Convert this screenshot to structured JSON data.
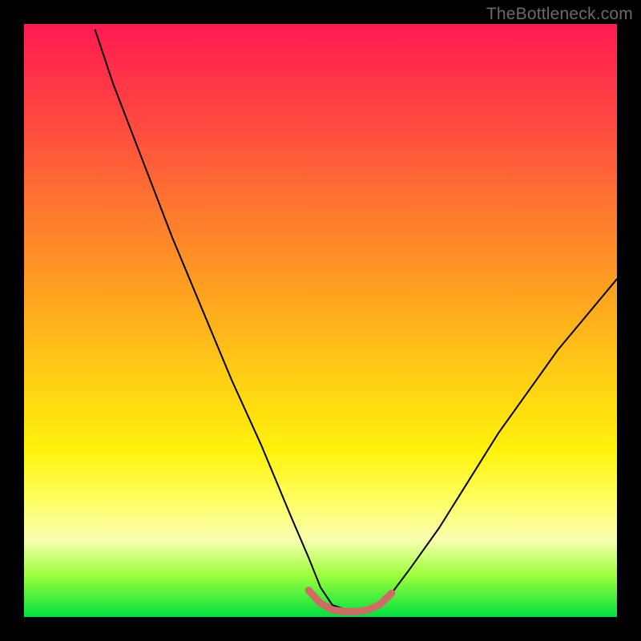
{
  "watermark": {
    "text": "TheBottleneck.com"
  },
  "chart_data": {
    "type": "line",
    "title": "",
    "xlabel": "",
    "ylabel": "",
    "xlim": [
      0,
      100
    ],
    "ylim": [
      0,
      100
    ],
    "grid": false,
    "legend": false,
    "series": [
      {
        "name": "bottleneck-curve",
        "x": [
          12,
          15,
          20,
          25,
          30,
          35,
          40,
          45,
          48,
          50,
          52,
          55,
          58,
          60,
          62,
          65,
          70,
          75,
          80,
          85,
          90,
          95,
          100
        ],
        "y": [
          99,
          90,
          77,
          64,
          52,
          40,
          29,
          17,
          10,
          5,
          2,
          1,
          1,
          2,
          4,
          8,
          15,
          23,
          31,
          38,
          45,
          51,
          57
        ],
        "stroke": "#000000",
        "stroke_width": 2
      }
    ],
    "markers": [
      {
        "name": "optimal-region-marker",
        "x": [
          48,
          50,
          52,
          54,
          56,
          58,
          60,
          62
        ],
        "y": [
          4.5,
          2.3,
          1.2,
          0.9,
          0.9,
          1.2,
          2.1,
          4.0
        ],
        "stroke": "#d06a64",
        "stroke_width": 9,
        "linecap": "round"
      }
    ],
    "background_gradient": {
      "direction": "top-to-bottom",
      "stops": [
        {
          "pos": 0.0,
          "color": "#ff1a52"
        },
        {
          "pos": 0.18,
          "color": "#ff4d3f"
        },
        {
          "pos": 0.46,
          "color": "#ffa41f"
        },
        {
          "pos": 0.72,
          "color": "#fff20a"
        },
        {
          "pos": 0.87,
          "color": "#f8ffb0"
        },
        {
          "pos": 1.0,
          "color": "#00e040"
        }
      ]
    }
  }
}
